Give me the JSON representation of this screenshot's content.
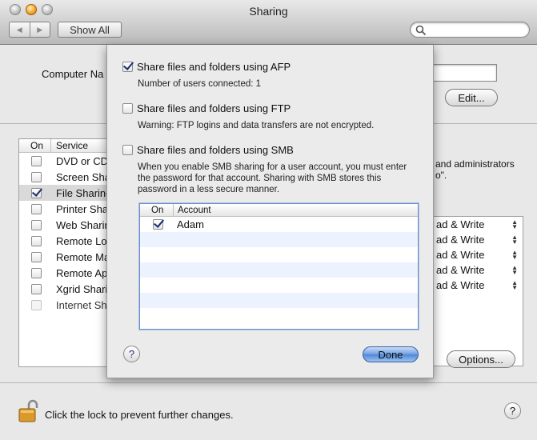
{
  "window": {
    "title": "Sharing"
  },
  "toolbar": {
    "back_glyph": "◀",
    "forward_glyph": "▶",
    "show_all_label": "Show All",
    "search_placeholder": ""
  },
  "computer_name": {
    "label": "Computer Na",
    "value": "",
    "edit_label": "Edit..."
  },
  "services": {
    "header_on": "On",
    "header_service": "Service",
    "items": [
      {
        "label": "DVD or CD",
        "on": false
      },
      {
        "label": "Screen Sha",
        "on": false
      },
      {
        "label": "File Sharing",
        "on": true,
        "selected": true
      },
      {
        "label": "Printer Sha",
        "on": false
      },
      {
        "label": "Web Sharin",
        "on": false
      },
      {
        "label": "Remote Lo",
        "on": false
      },
      {
        "label": "Remote Ma",
        "on": false
      },
      {
        "label": "Remote Ap",
        "on": false
      },
      {
        "label": "Xgrid Shari",
        "on": false
      },
      {
        "label": "Internet Sh",
        "on": false,
        "disabled": true
      }
    ]
  },
  "background_right": {
    "text_line1": "and administrators",
    "text_line2": "o\".",
    "permissions": [
      "ad & Write",
      "ad & Write",
      "ad & Write",
      "ad & Write",
      "ad & Write"
    ],
    "options_label": "Options..."
  },
  "lock": {
    "text": "Click the lock to prevent further changes."
  },
  "help_glyph": "?",
  "sheet": {
    "afp": {
      "label": "Share files and folders using AFP",
      "checked": true,
      "note": "Number of users connected: 1"
    },
    "ftp": {
      "label": "Share files and folders using FTP",
      "checked": false,
      "note": "Warning: FTP logins and data transfers are not encrypted."
    },
    "smb": {
      "label": "Share files and folders using SMB",
      "checked": false,
      "note_line1": "When you enable SMB sharing for a user account, you must enter",
      "note_line2": "the password for that account. Sharing with SMB stores this",
      "note_line3": "password in a less secure manner."
    },
    "accounts": {
      "header_on": "On",
      "header_account": "Account",
      "rows": [
        {
          "name": "Adam",
          "on": true
        }
      ]
    },
    "done_label": "Done"
  },
  "colors": {
    "accent": "#5b8fd9",
    "row_alt": "#edf3fe",
    "check": "#1a2b6e"
  }
}
